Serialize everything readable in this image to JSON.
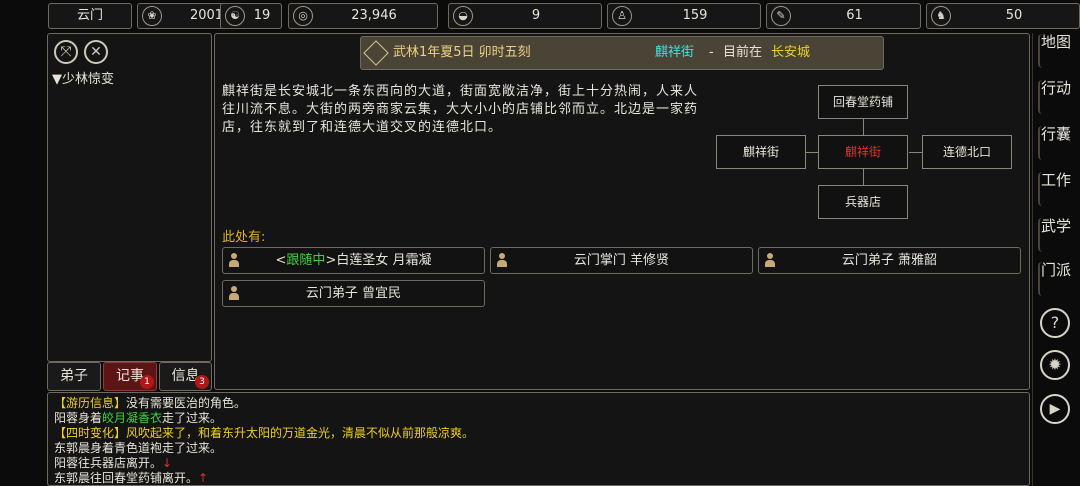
{
  "stats": {
    "sect": "云门",
    "age": "2001",
    "morality": "19",
    "money": "23,946",
    "food": "9",
    "stamina": "159",
    "energy": "61",
    "horse": "50"
  },
  "stat_icons": [
    "fan-icon",
    "yin-yang-icon",
    "coin-icon",
    "rice-bowl-icon",
    "gourd-icon",
    "scroll-icon",
    "horse-icon"
  ],
  "left_panel": {
    "quest_title": "▼少林惊变",
    "tabs": [
      {
        "label": "弟子",
        "badge": ""
      },
      {
        "label": "记事",
        "badge": "1"
      },
      {
        "label": "信息",
        "badge": "3"
      }
    ]
  },
  "header": {
    "date": "武林1年夏5日 卯时五刻",
    "location_name": "麒祥街",
    "separator": "-",
    "location_prefix": "目前在",
    "city": "长安城"
  },
  "description": "麒祥街是长安城北一条东西向的大道，街面宽敞洁净，街上十分热闹，人来人往川流不息。大街的两旁商家云集，大大小小的店铺比邻而立。北边是一家药店，往东就到了和连德大道交叉的连德北口。",
  "map": {
    "north": "回春堂药铺",
    "west": "麒祥街",
    "center": "麒祥街",
    "east": "连德北口",
    "south": "兵器店"
  },
  "npcs_label": "此处有:",
  "npcs": [
    {
      "prefix": "<",
      "status": "跟随中",
      "suffix": ">",
      "name": "白莲圣女 月霜凝"
    },
    {
      "prefix": "",
      "status": "",
      "suffix": "",
      "name": "云门掌门 羊修贤"
    },
    {
      "prefix": "",
      "status": "",
      "suffix": "",
      "name": "云门弟子 萧雅韶"
    },
    {
      "prefix": "",
      "status": "",
      "suffix": "",
      "name": "云门弟子 曾宜民"
    }
  ],
  "right_menu": [
    "地图",
    "行动",
    "行囊",
    "工作",
    "武学",
    "门派"
  ],
  "log": [
    {
      "tag": "【游历信息】",
      "text": "没有需要医治的角色。"
    },
    {
      "pre": "阳蓉身着",
      "green": "皎月凝香衣",
      "post": "走了过来。"
    },
    {
      "tag": "【四时变化】",
      "text_green": "风吹起来了，和着东升太阳的万道金光，清晨不似从前那般凉爽。"
    },
    {
      "plain": "东郭晨身着青色道袍走了过来。"
    },
    {
      "plain": "阳蓉往兵器店离开。",
      "arrow": "↓"
    },
    {
      "plain": "东郭晨往回春堂药铺离开。",
      "arrow": "↑"
    }
  ],
  "colors": {
    "accent_red": "#e03030",
    "highlight_yellow": "#f0d020",
    "highlight_green": "#40d040",
    "cyan": "#40e0e0"
  }
}
